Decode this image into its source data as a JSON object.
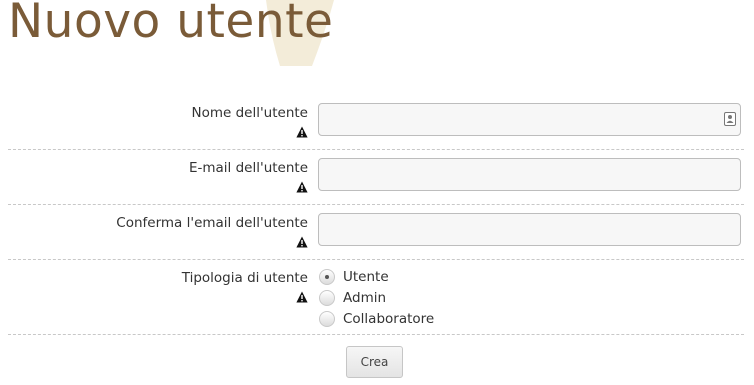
{
  "page": {
    "title": "Nuovo utente"
  },
  "form": {
    "fields": [
      {
        "label": "Nome dell'utente",
        "value": "",
        "placeholder": "",
        "required": true
      },
      {
        "label": "E-mail dell'utente",
        "value": "",
        "placeholder": "",
        "required": true
      },
      {
        "label": "Conferma l'email dell'utente",
        "value": "",
        "placeholder": "",
        "required": true
      }
    ],
    "user_type": {
      "label": "Tipologia di utente",
      "required": true,
      "options": [
        "Utente",
        "Admin",
        "Collaboratore"
      ],
      "selected": "Utente"
    },
    "submit_label": "Crea"
  },
  "icons": {
    "required": "warning-triangle-icon",
    "autofill": "contact-card-icon"
  },
  "colors": {
    "title": "#7a5b38",
    "watermark": "#f3ecd9",
    "input_background": "#f7f7f7",
    "divider": "#c8c8c8"
  }
}
